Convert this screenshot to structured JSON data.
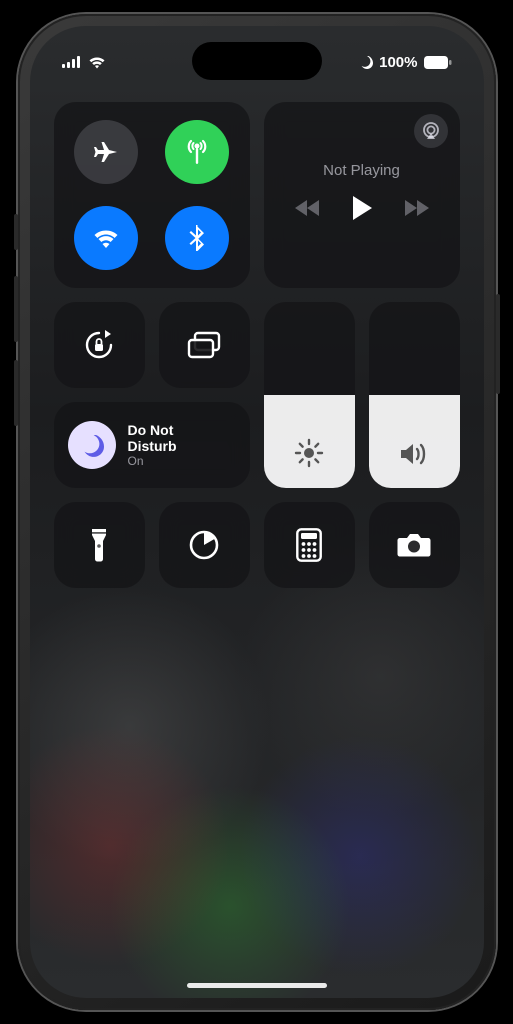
{
  "status": {
    "battery_percent": "100%"
  },
  "media": {
    "title": "Not Playing"
  },
  "focus": {
    "label": "Do Not\nDisturb",
    "status": "On"
  },
  "sliders": {
    "brightness_fill_pct": 50,
    "volume_fill_pct": 50
  },
  "colors": {
    "toggle_blue": "#0a7aff",
    "toggle_green": "#30d158",
    "dnd_lilac": "#e6e0ff"
  }
}
